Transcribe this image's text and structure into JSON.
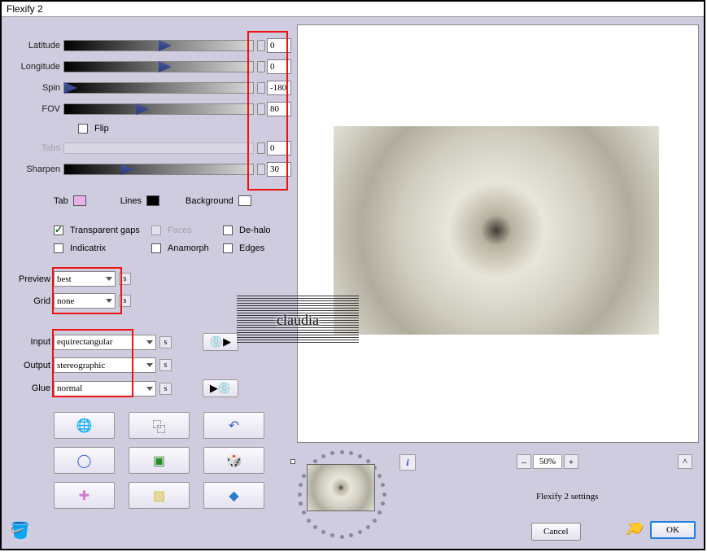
{
  "title": "Flexify 2",
  "sliders": {
    "latitude": {
      "label": "Latitude",
      "value": "0",
      "thumb_pct": 50
    },
    "longitude": {
      "label": "Longitude",
      "value": "0",
      "thumb_pct": 50
    },
    "spin": {
      "label": "Spin",
      "value": "-180",
      "thumb_pct": 0
    },
    "fov": {
      "label": "FOV",
      "value": "80",
      "thumb_pct": 38
    },
    "tabs": {
      "label": "Tabs",
      "value": "0",
      "thumb_pct": 0,
      "disabled": true
    },
    "sharpen": {
      "label": "Sharpen",
      "value": "30",
      "thumb_pct": 30
    }
  },
  "flip": {
    "label": "Flip",
    "checked": false
  },
  "colors": {
    "tab_label": "Tab",
    "tab": "#e6b3e6",
    "lines_label": "Lines",
    "lines": "#000000",
    "bg_label": "Background",
    "bg": "#ffffff"
  },
  "checks": {
    "transparent_gaps": {
      "label": "Transparent gaps",
      "checked": true
    },
    "faces": {
      "label": "Faces",
      "checked": false,
      "dim": true
    },
    "dehalo": {
      "label": "De-halo",
      "checked": false
    },
    "indicatrix": {
      "label": "Indicatrix",
      "checked": false
    },
    "anamorph": {
      "label": "Anamorph",
      "checked": false
    },
    "edges": {
      "label": "Edges",
      "checked": false
    }
  },
  "dropdowns": {
    "preview": {
      "label": "Preview",
      "value": "best"
    },
    "grid": {
      "label": "Grid",
      "value": "none"
    },
    "input": {
      "label": "Input",
      "value": "equirectangular"
    },
    "output": {
      "label": "Output",
      "value": "stereographic"
    },
    "glue": {
      "label": "Glue",
      "value": "normal"
    }
  },
  "watermark_text": "claudia",
  "zoom": {
    "minus": "–",
    "value": "50%",
    "plus": "+",
    "reset": "^"
  },
  "settings_title": "Flexify 2 settings",
  "buttons": {
    "info": "i",
    "cancel": "Cancel",
    "ok": "OK"
  },
  "save_glyph": "s"
}
